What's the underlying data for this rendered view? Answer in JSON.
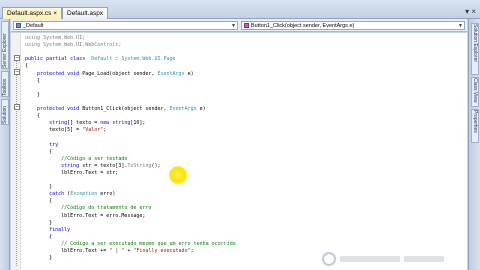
{
  "tabs": [
    {
      "label": "Default.aspx.cs",
      "active": true
    },
    {
      "label": "Default.aspx",
      "active": false
    }
  ],
  "window_buttons": "▾ ×",
  "left_panels": [
    "Server Explorer",
    "Toolbox",
    "Solution"
  ],
  "right_panels": [
    "Solution Explorer",
    "Class View",
    "Properties"
  ],
  "nav": {
    "class_combo": "_Default",
    "member_combo": "Button1_Click(object sender, EventArgs e)"
  },
  "code_lines": [
    [
      {
        "t": "using ",
        "c": "gy"
      },
      {
        "t": "System.Web.UI;",
        "c": "gy"
      }
    ],
    [
      {
        "t": "using ",
        "c": "gy"
      },
      {
        "t": "System.Web.UI.WebControls;",
        "c": "gy"
      }
    ],
    [],
    [
      {
        "t": "public partial class ",
        "c": "kw"
      },
      {
        "t": "_Default",
        "c": "ty"
      },
      {
        "t": " : "
      },
      {
        "t": "System.Web.UI.Page",
        "c": "ty"
      }
    ],
    [
      {
        "t": "{"
      }
    ],
    [
      {
        "t": "    "
      },
      {
        "t": "protected void ",
        "c": "kw"
      },
      {
        "t": "Page_Load(object sender, "
      },
      {
        "t": "EventArgs",
        "c": "ty"
      },
      {
        "t": " e)"
      }
    ],
    [
      {
        "t": "    {"
      }
    ],
    [],
    [
      {
        "t": "    }"
      }
    ],
    [],
    [
      {
        "t": "    "
      },
      {
        "t": "protected void ",
        "c": "kw"
      },
      {
        "t": "Button1_Click(object sender, "
      },
      {
        "t": "EventArgs",
        "c": "ty"
      },
      {
        "t": " e)"
      }
    ],
    [
      {
        "t": "    {"
      }
    ],
    [
      {
        "t": "        "
      },
      {
        "t": "string",
        "c": "kw"
      },
      {
        "t": "[] texto = "
      },
      {
        "t": "new ",
        "c": "kw"
      },
      {
        "t": "string",
        "c": "kw"
      },
      {
        "t": "[10];"
      }
    ],
    [
      {
        "t": "        texto[5] = "
      },
      {
        "t": "\"Valor\"",
        "c": "st"
      },
      {
        "t": ";"
      }
    ],
    [],
    [
      {
        "t": "        "
      },
      {
        "t": "try",
        "c": "kw"
      }
    ],
    [
      {
        "t": "        {"
      }
    ],
    [
      {
        "t": "            "
      },
      {
        "t": "//Código a ser testado",
        "c": "cm"
      }
    ],
    [
      {
        "t": "            "
      },
      {
        "t": "string",
        "c": "kw"
      },
      {
        "t": " str = texto[3]."
      },
      {
        "t": "ToString",
        "c": "gy"
      },
      {
        "t": "();"
      }
    ],
    [
      {
        "t": "            lblErro.Text = str;"
      }
    ],
    [],
    [
      {
        "t": "        }"
      }
    ],
    [
      {
        "t": "        "
      },
      {
        "t": "catch",
        "c": "kw"
      },
      {
        "t": " ("
      },
      {
        "t": "Exception",
        "c": "ty"
      },
      {
        "t": " erro)"
      }
    ],
    [
      {
        "t": "        {"
      }
    ],
    [
      {
        "t": "            "
      },
      {
        "t": "//Código do tratamento de erro",
        "c": "cm"
      }
    ],
    [
      {
        "t": "            lblErro.Text = erro.Message;"
      }
    ],
    [
      {
        "t": "        }"
      }
    ],
    [
      {
        "t": "        "
      },
      {
        "t": "finally",
        "c": "kw"
      }
    ],
    [
      {
        "t": "        {"
      }
    ],
    [
      {
        "t": "            "
      },
      {
        "t": "// Código a ser executado mesmo que um erro tenha ocorrido",
        "c": "cm"
      }
    ],
    [
      {
        "t": "            lblErro.Text += "
      },
      {
        "t": "\" | \"",
        "c": "st"
      },
      {
        "t": " + "
      },
      {
        "t": "\"Finally executado\"",
        "c": "st"
      },
      {
        "t": ";"
      }
    ],
    [
      {
        "t": "        }"
      }
    ]
  ]
}
